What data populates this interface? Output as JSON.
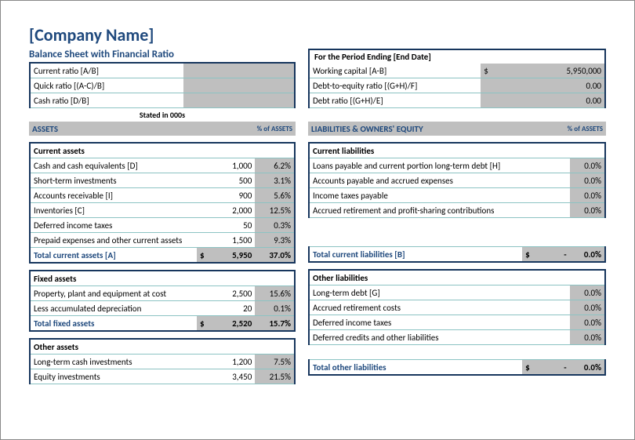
{
  "title": "[Company Name]",
  "subtitle": "Balance Sheet with Financial Ratio",
  "period_label": "For the Period Ending [End Date]",
  "stated_note": "Stated in 000s",
  "headers": {
    "assets": "ASSETS",
    "pct_assets": "% of ASSETS",
    "liab": "LIABILITIES & OWNERS' EQUITY",
    "pct_liab": "% of ASSETS"
  },
  "ratios_left": [
    {
      "label": "Current ratio  [A/B]",
      "value": ""
    },
    {
      "label": "Quick ratio  [(A-C)/B]",
      "value": ""
    },
    {
      "label": "Cash ratio  [D/B]",
      "value": ""
    }
  ],
  "ratios_right": [
    {
      "label": "Working capital  [A-B]",
      "value": "5,950,000",
      "dollar": true
    },
    {
      "label": "Debt-to-equity ratio  [(G+H)/F]",
      "value": "0.00"
    },
    {
      "label": "Debt ratio  [(G+H)/E]",
      "value": "0.00"
    }
  ],
  "current_assets": {
    "title": "Current assets",
    "rows": [
      {
        "label": "Cash and cash equivalents  [D]",
        "value": "1,000",
        "pct": "6.2%"
      },
      {
        "label": "Short-term investments",
        "value": "500",
        "pct": "3.1%"
      },
      {
        "label": "Accounts receivable  [I]",
        "value": "900",
        "pct": "5.6%"
      },
      {
        "label": "Inventories  [C]",
        "value": "2,000",
        "pct": "12.5%"
      },
      {
        "label": "Deferred income taxes",
        "value": "50",
        "pct": "0.3%"
      },
      {
        "label": "Prepaid expenses and other current assets",
        "value": "1,500",
        "pct": "9.3%"
      }
    ],
    "total": {
      "label": "Total current assets  [A]",
      "value": "5,950",
      "pct": "37.0%",
      "dollar": true
    }
  },
  "fixed_assets": {
    "title": "Fixed assets",
    "rows": [
      {
        "label": "Property, plant and equipment at cost",
        "value": "2,500",
        "pct": "15.6%"
      },
      {
        "label": "Less accumulated depreciation",
        "value": "20",
        "pct": "0.1%"
      }
    ],
    "total": {
      "label": "Total fixed assets",
      "value": "2,520",
      "pct": "15.7%",
      "dollar": true
    }
  },
  "other_assets": {
    "title": "Other assets",
    "rows": [
      {
        "label": "Long-term cash investments",
        "value": "1,200",
        "pct": "7.5%"
      },
      {
        "label": "Equity investments",
        "value": "3,450",
        "pct": "21.5%"
      }
    ]
  },
  "current_liab": {
    "title": "Current liabilities",
    "rows": [
      {
        "label": "Loans payable and current portion long-term debt  [H]",
        "value": "",
        "pct": "0.0%"
      },
      {
        "label": "Accounts payable and accrued expenses",
        "value": "",
        "pct": "0.0%"
      },
      {
        "label": "Income taxes payable",
        "value": "",
        "pct": "0.0%"
      },
      {
        "label": "Accrued retirement and profit-sharing contributions",
        "value": "",
        "pct": "0.0%"
      }
    ],
    "total": {
      "label": "Total current liabilities  [B]",
      "value": "-",
      "pct": "0.0%",
      "dollar": true
    }
  },
  "other_liab": {
    "title": "Other liabilities",
    "rows": [
      {
        "label": "Long-term debt  [G]",
        "value": "",
        "pct": "0.0%"
      },
      {
        "label": "Accrued retirement costs",
        "value": "",
        "pct": "0.0%"
      },
      {
        "label": "Deferred income taxes",
        "value": "",
        "pct": "0.0%"
      },
      {
        "label": "Deferred credits and other liabilities",
        "value": "",
        "pct": "0.0%"
      }
    ],
    "total": {
      "label": "Total other liabilities",
      "value": "-",
      "pct": "0.0%",
      "dollar": true
    }
  }
}
